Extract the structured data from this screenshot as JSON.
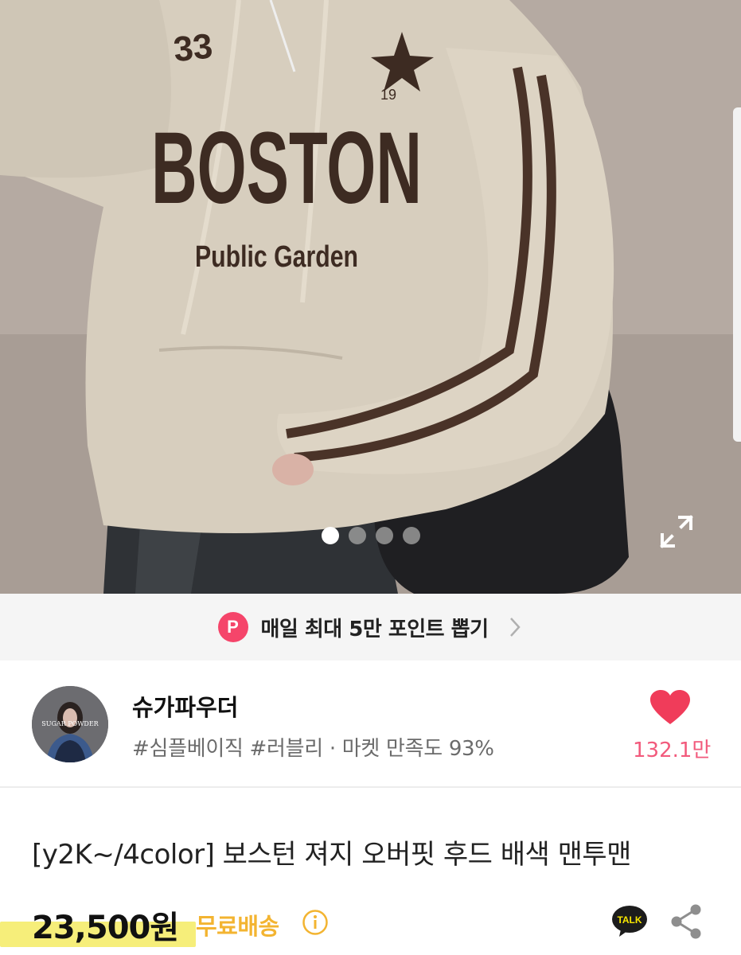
{
  "hero": {
    "print_top": "33",
    "print_main": "BOSTON",
    "print_sub": "Public Garden",
    "print_year": "19",
    "carousel_dots": 4,
    "active_dot": 0
  },
  "point_banner": {
    "badge": "P",
    "text": "매일 최대 5만 포인트 뽑기"
  },
  "seller": {
    "name": "슈가파우더",
    "tags": "#심플베이직 #러블리 · 마켓 만족도 93%",
    "avatar_text": "SUGAR POWDER",
    "like_count": "132.1만"
  },
  "product": {
    "title": "[y2K~/4color] 보스턴 져지 오버핏 후드 배색 맨투맨",
    "price": "23,500원",
    "shipping": "무료배송",
    "talk_label": "TALK"
  },
  "colors": {
    "accent_pink": "#f5456a",
    "like_pink": "#f25a7c",
    "shipping_yellow": "#f3b431",
    "price_highlight": "#f6ee7a"
  },
  "icons": [
    "expand-icon",
    "chevron-right-icon",
    "heart-icon",
    "info-icon",
    "kakao-talk-icon",
    "share-icon"
  ]
}
